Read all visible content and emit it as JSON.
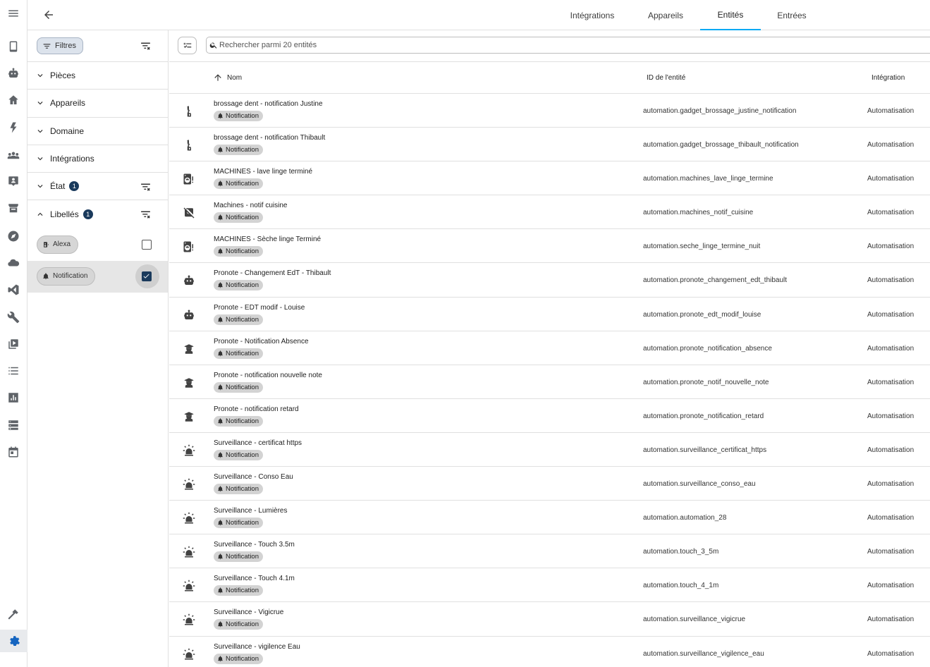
{
  "header": {
    "tabs": [
      {
        "label": "Intégrations",
        "active": false
      },
      {
        "label": "Appareils",
        "active": false
      },
      {
        "label": "Entités",
        "active": true
      },
      {
        "label": "Entrées",
        "active": false
      }
    ]
  },
  "rail": {
    "items": [
      "menu-icon",
      "tablet-icon",
      "robot-icon",
      "home-icon",
      "lightning-icon",
      "people-icon",
      "badge-icon",
      "hacs-icon",
      "compass-icon",
      "cloud-icon",
      "vscode-icon",
      "wrench-icon",
      "media-icon",
      "list-icon",
      "chart-icon",
      "server-icon",
      "calendar-icon",
      "hammer-icon",
      "cog-icon"
    ],
    "accent": "#1565c0"
  },
  "filters": {
    "button_label": "Filtres",
    "sections": [
      {
        "label": "Pièces",
        "expanded": false,
        "count": ""
      },
      {
        "label": "Appareils",
        "expanded": false,
        "count": ""
      },
      {
        "label": "Domaine",
        "expanded": false,
        "count": ""
      },
      {
        "label": "Intégrations",
        "expanded": false,
        "count": ""
      },
      {
        "label": "État",
        "expanded": false,
        "count": "1"
      },
      {
        "label": "Libellés",
        "expanded": true,
        "count": "1"
      }
    ],
    "labels": [
      {
        "label": "Alexa",
        "checked": false
      },
      {
        "label": "Notification",
        "checked": true
      }
    ]
  },
  "search": {
    "placeholder": "Rechercher parmi 20 entités"
  },
  "table": {
    "columns": {
      "name": "Nom",
      "entity_id": "ID de l'entité",
      "integration": "Intégration"
    },
    "tag_label": "Notification",
    "rows": [
      {
        "icon": "toothbrush-icon",
        "name": "brossage dent - notification Justine",
        "entity_id": "automation.gadget_brossage_justine_notification",
        "integration": "Automatisation"
      },
      {
        "icon": "toothbrush-icon",
        "name": "brossage dent - notification Thibault",
        "entity_id": "automation.gadget_brossage_thibault_notification",
        "integration": "Automatisation"
      },
      {
        "icon": "washing-machine-alert-icon",
        "name": "MACHINES - lave linge terminé",
        "entity_id": "automation.machines_lave_linge_termine",
        "integration": "Automatisation"
      },
      {
        "icon": "dishwasher-off-icon",
        "name": "Machines - notif cuisine",
        "entity_id": "automation.machines_notif_cuisine",
        "integration": "Automatisation"
      },
      {
        "icon": "washing-machine-alert-icon",
        "name": "MACHINES - Sèche linge Terminé",
        "entity_id": "automation.seche_linge_termine_nuit",
        "integration": "Automatisation"
      },
      {
        "icon": "robot-icon",
        "name": "Pronote - Changement EdT - Thibault",
        "entity_id": "automation.pronote_changement_edt_thibault",
        "integration": "Automatisation"
      },
      {
        "icon": "robot-icon",
        "name": "Pronote - EDT modif - Louise",
        "entity_id": "automation.pronote_edt_modif_louise",
        "integration": "Automatisation"
      },
      {
        "icon": "student-icon",
        "name": "Pronote - Notification Absence",
        "entity_id": "automation.pronote_notification_absence",
        "integration": "Automatisation"
      },
      {
        "icon": "student-icon",
        "name": "Pronote - notification nouvelle note",
        "entity_id": "automation.pronote_notif_nouvelle_note",
        "integration": "Automatisation"
      },
      {
        "icon": "student-icon",
        "name": "Pronote - notification retard",
        "entity_id": "automation.pronote_notification_retard",
        "integration": "Automatisation"
      },
      {
        "icon": "alarm-light-icon",
        "name": "Surveillance - certificat https",
        "entity_id": "automation.surveillance_certificat_https",
        "integration": "Automatisation"
      },
      {
        "icon": "alarm-light-icon",
        "name": "Surveillance - Conso Eau",
        "entity_id": "automation.surveillance_conso_eau",
        "integration": "Automatisation"
      },
      {
        "icon": "alarm-light-icon",
        "name": "Surveillance - Lumières",
        "entity_id": "automation.automation_28",
        "integration": "Automatisation"
      },
      {
        "icon": "alarm-light-icon",
        "name": "Surveillance - Touch 3.5m",
        "entity_id": "automation.touch_3_5m",
        "integration": "Automatisation"
      },
      {
        "icon": "alarm-light-icon",
        "name": "Surveillance - Touch 4.1m",
        "entity_id": "automation.touch_4_1m",
        "integration": "Automatisation"
      },
      {
        "icon": "alarm-light-icon",
        "name": "Surveillance - Vigicrue",
        "entity_id": "automation.surveillance_vigicrue",
        "integration": "Automatisation"
      },
      {
        "icon": "alarm-light-icon",
        "name": "Surveillance - vigilence Eau",
        "entity_id": "automation.surveillance_vigilence_eau",
        "integration": "Automatisation"
      }
    ]
  }
}
